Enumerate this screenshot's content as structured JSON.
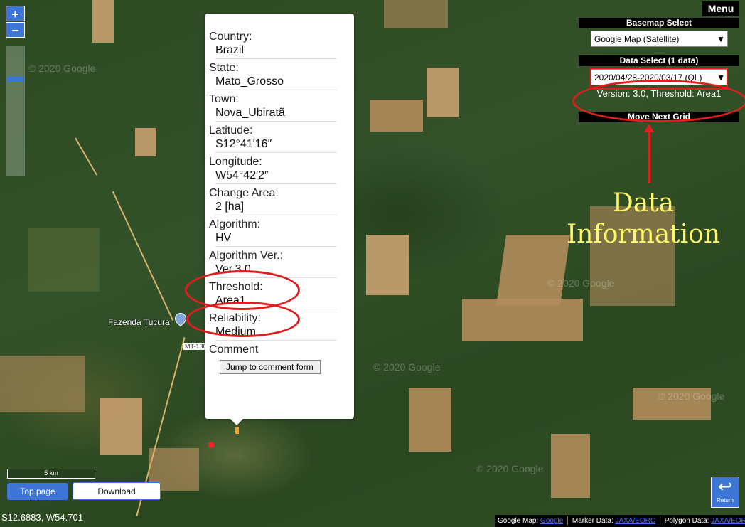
{
  "map": {
    "watermarks": [
      "© 2020 Google",
      "© 2020 Google",
      "© 2020 Google",
      "© 2020 Google",
      "© 2020 Google"
    ],
    "place_label": "Fazenda Tucura",
    "road_label": "MT-130",
    "scale_label": "5 km",
    "coordinates": "S12.6883, W54.701"
  },
  "zoom": {
    "in_label": "+",
    "out_label": "−"
  },
  "popup": {
    "fields": [
      {
        "label": "Country:",
        "value": "Brazil"
      },
      {
        "label": "State:",
        "value": "Mato_Grosso"
      },
      {
        "label": "Town:",
        "value": "Nova_Ubiratã"
      },
      {
        "label": "Latitude:",
        "value": "S12°41′16″"
      },
      {
        "label": "Longitude:",
        "value": "W54°42′2″"
      },
      {
        "label": "Change Area:",
        "value": "2 [ha]"
      },
      {
        "label": "Algorithm:",
        "value": "HV"
      },
      {
        "label": "Algorithm Ver.:",
        "value": "Ver.3.0"
      },
      {
        "label": "Threshold:",
        "value": "Area1"
      },
      {
        "label": "Reliability:",
        "value": "Medium"
      }
    ],
    "comment_label": "Comment",
    "jump_button": "Jump to comment form"
  },
  "panel": {
    "menu_label": "Menu",
    "basemap_header": "Basemap Select",
    "basemap_value": "Google Map (Satellite)",
    "data_header": "Data Select (1 data)",
    "data_value": "2020/04/28-2020/03/17 (QL)",
    "version_text": "Version: 3.0, Threshold: Area1",
    "move_next": "Move Next Grid"
  },
  "annotation": {
    "line1": "Data",
    "line2": "Information",
    "color": "#fff86a",
    "mark_color": "#e21d1d"
  },
  "buttons": {
    "top_page": "Top page",
    "download": "Download",
    "return": "Return"
  },
  "credits": {
    "google_map": "Google Map:",
    "google_link": "Google",
    "marker_data": "Marker Data:",
    "marker_link": "JAXA/EORC",
    "polygon_data": "Polygon Data:",
    "polygon_link": "JAXA/EORC"
  }
}
